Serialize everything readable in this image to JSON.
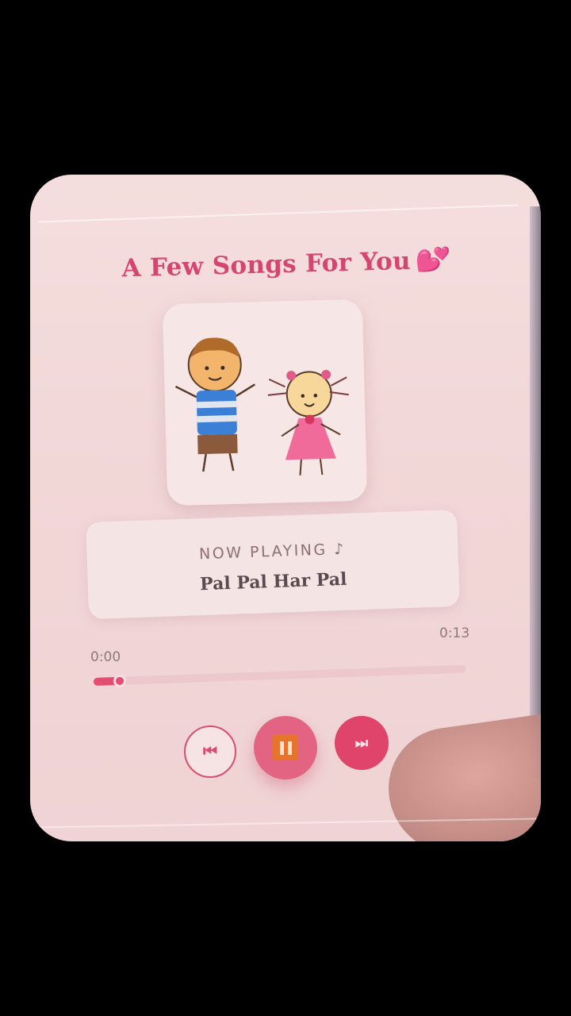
{
  "player": {
    "title": "A Few Songs For You",
    "heart_icon": "two-hearts-icon",
    "now_playing_label": "NOW PLAYING ♪",
    "song_title": "Pal Pal Har Pal",
    "elapsed": "0:00",
    "duration": "0:13",
    "progress_fraction": 0.07,
    "controls": {
      "prev_icon": "skip-previous-icon",
      "play_icon": "pause-icon",
      "next_icon": "skip-next-icon"
    },
    "colors": {
      "accent": "#e0446b",
      "title": "#d4466e",
      "background": "#f2d8d8"
    }
  }
}
